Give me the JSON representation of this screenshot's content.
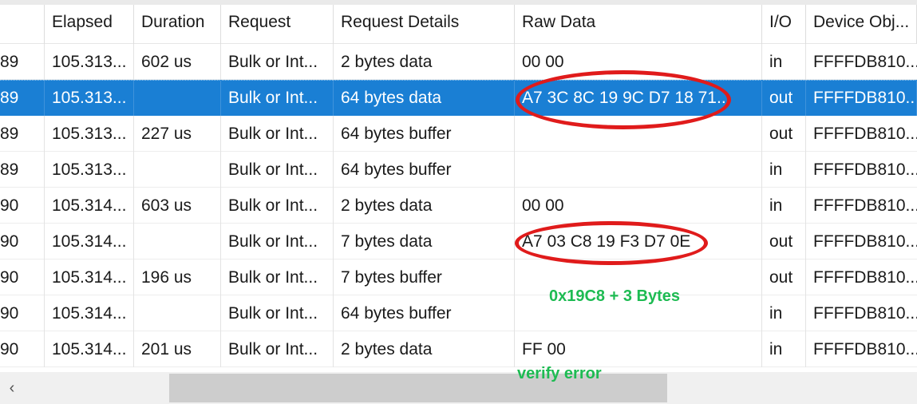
{
  "table": {
    "columns": [
      {
        "key": "num",
        "label": ""
      },
      {
        "key": "elapsed",
        "label": "Elapsed"
      },
      {
        "key": "duration",
        "label": "Duration"
      },
      {
        "key": "request",
        "label": "Request"
      },
      {
        "key": "details",
        "label": "Request Details"
      },
      {
        "key": "rawdata",
        "label": "Raw Data"
      },
      {
        "key": "io",
        "label": "I/O"
      },
      {
        "key": "device",
        "label": "Device Obj..."
      }
    ],
    "rows": [
      {
        "num": "89",
        "elapsed": "105.313...",
        "duration": "602 us",
        "request": "Bulk or Int...",
        "details": "2 bytes data",
        "rawdata": "00 00",
        "io": "in",
        "device": "FFFFDB810...",
        "selected": false
      },
      {
        "num": "89",
        "elapsed": "105.313...",
        "duration": "",
        "request": "Bulk or Int...",
        "details": "64 bytes data",
        "rawdata": "A7 3C 8C 19 9C D7 18 71...",
        "io": "out",
        "device": "FFFFDB810...",
        "selected": true
      },
      {
        "num": "89",
        "elapsed": "105.313...",
        "duration": "227 us",
        "request": "Bulk or Int...",
        "details": "64 bytes buffer",
        "rawdata": "",
        "io": "out",
        "device": "FFFFDB810...",
        "selected": false
      },
      {
        "num": "89",
        "elapsed": "105.313...",
        "duration": "",
        "request": "Bulk or Int...",
        "details": "64 bytes buffer",
        "rawdata": "",
        "io": "in",
        "device": "FFFFDB810...",
        "selected": false
      },
      {
        "num": "90",
        "elapsed": "105.314...",
        "duration": "603 us",
        "request": "Bulk or Int...",
        "details": "2 bytes data",
        "rawdata": "00 00",
        "io": "in",
        "device": "FFFFDB810...",
        "selected": false
      },
      {
        "num": "90",
        "elapsed": "105.314...",
        "duration": "",
        "request": "Bulk or Int...",
        "details": "7 bytes data",
        "rawdata": "A7 03 C8 19 F3 D7 0E",
        "io": "out",
        "device": "FFFFDB810...",
        "selected": false
      },
      {
        "num": "90",
        "elapsed": "105.314...",
        "duration": "196 us",
        "request": "Bulk or Int...",
        "details": "7 bytes buffer",
        "rawdata": "",
        "io": "out",
        "device": "FFFFDB810...",
        "selected": false
      },
      {
        "num": "90",
        "elapsed": "105.314...",
        "duration": "",
        "request": "Bulk or Int...",
        "details": "64 bytes buffer",
        "rawdata": "",
        "io": "in",
        "device": "FFFFDB810...",
        "selected": false
      },
      {
        "num": "90",
        "elapsed": "105.314...",
        "duration": "201 us",
        "request": "Bulk or Int...",
        "details": "2 bytes data",
        "rawdata": "FF 00",
        "io": "in",
        "device": "FFFFDB810...",
        "selected": false
      }
    ]
  },
  "annotations": {
    "color_circle": "#e01b1b",
    "color_note": "#1dbb52",
    "notes": [
      {
        "id": "bytes",
        "text": "0x19C8 + 3 Bytes"
      },
      {
        "id": "verify",
        "text": "verify error"
      }
    ]
  },
  "scrollbar": {
    "left_arrow_glyph": "‹"
  }
}
